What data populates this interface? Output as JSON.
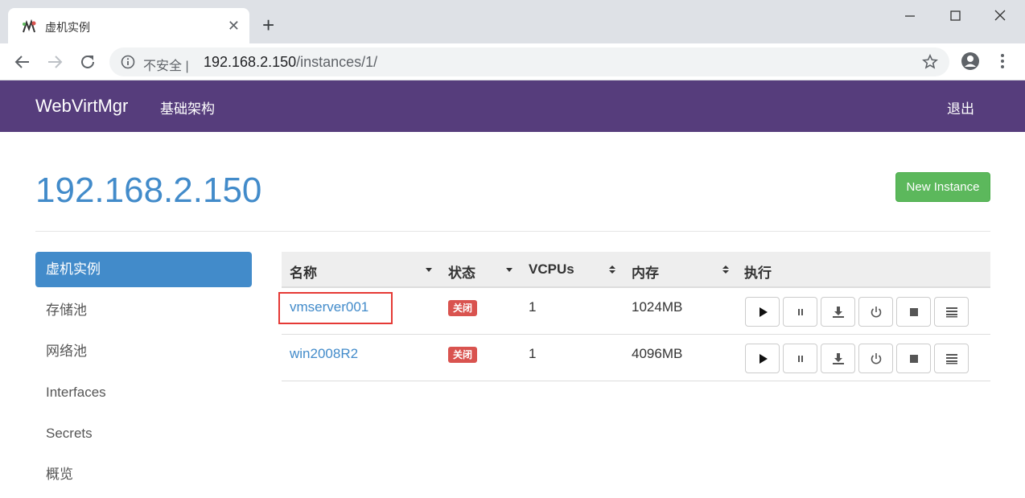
{
  "browser": {
    "tab_title": "虚机实例",
    "security_label": "不安全 |",
    "url_host": "192.168.2.150",
    "url_path": "/instances/1/"
  },
  "navbar": {
    "brand": "WebVirtMgr",
    "infrastructure": "基础架构",
    "logout": "退出"
  },
  "page": {
    "title": "192.168.2.150",
    "new_instance_label": "New Instance"
  },
  "sidebar": {
    "items": [
      {
        "label": "虚机实例",
        "active": true
      },
      {
        "label": "存储池",
        "active": false
      },
      {
        "label": "网络池",
        "active": false
      },
      {
        "label": "Interfaces",
        "active": false
      },
      {
        "label": "Secrets",
        "active": false
      },
      {
        "label": "概览",
        "active": false
      }
    ]
  },
  "table": {
    "headers": {
      "name": "名称",
      "status": "状态",
      "vcpus": "VCPUs",
      "memory": "内存",
      "actions": "执行"
    },
    "rows": [
      {
        "name": "vmserver001",
        "status": "关闭",
        "vcpus": "1",
        "memory": "1024MB",
        "highlighted": true
      },
      {
        "name": "win2008R2",
        "status": "关闭",
        "vcpus": "1",
        "memory": "4096MB",
        "highlighted": false
      }
    ],
    "action_icons": [
      "play-icon",
      "pause-icon",
      "download-icon",
      "power-icon",
      "stop-icon",
      "list-icon"
    ]
  },
  "colors": {
    "navbar": "#563d7c",
    "link": "#428bca",
    "success": "#5cb85c",
    "danger": "#d9534f",
    "highlight_box": "#e53935"
  }
}
